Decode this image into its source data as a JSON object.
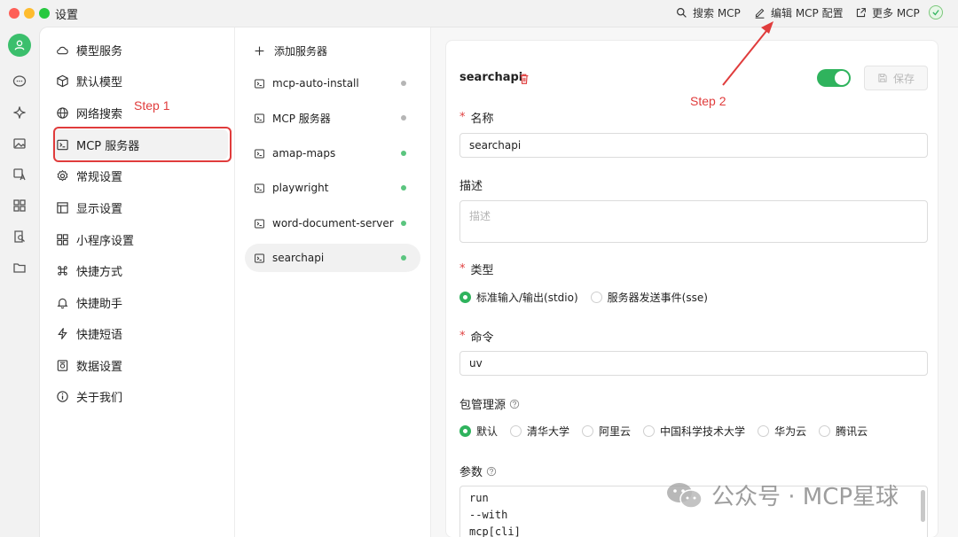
{
  "window": {
    "title": "设置"
  },
  "topbar": {
    "search_mcp": "搜索 MCP",
    "edit_mcp_config": "编辑 MCP 配置",
    "more_mcp": "更多 MCP"
  },
  "settings_menu": [
    {
      "label": "模型服务",
      "icon": "cloud-icon"
    },
    {
      "label": "默认模型",
      "icon": "cube-icon"
    },
    {
      "label": "网络搜索",
      "icon": "globe-icon"
    },
    {
      "label": "MCP 服务器",
      "icon": "terminal-icon",
      "active": true
    },
    {
      "label": "常规设置",
      "icon": "gear-icon"
    },
    {
      "label": "显示设置",
      "icon": "layout-icon"
    },
    {
      "label": "小程序设置",
      "icon": "grid-icon"
    },
    {
      "label": "快捷方式",
      "icon": "command-icon"
    },
    {
      "label": "快捷助手",
      "icon": "bell-icon"
    },
    {
      "label": "快捷短语",
      "icon": "zap-icon"
    },
    {
      "label": "数据设置",
      "icon": "database-icon"
    },
    {
      "label": "关于我们",
      "icon": "info-icon"
    }
  ],
  "annotations": {
    "step1": "Step 1",
    "step2": "Step 2"
  },
  "servers": {
    "add_label": "添加服务器",
    "items": [
      {
        "name": "mcp-auto-install",
        "status": "inactive"
      },
      {
        "name": "MCP 服务器",
        "status": "inactive"
      },
      {
        "name": "amap-maps",
        "status": "active"
      },
      {
        "name": "playwright",
        "status": "active"
      },
      {
        "name": "word-document-server",
        "status": "active"
      },
      {
        "name": "searchapi",
        "status": "active",
        "selected": true
      }
    ]
  },
  "detail": {
    "title": "searchapi",
    "enabled": true,
    "save_label": "保存",
    "name_label": "名称",
    "name_value": "searchapi",
    "desc_label": "描述",
    "desc_placeholder": "描述",
    "type_label": "类型",
    "type_options": [
      "标准输入/输出(stdio)",
      "服务器发送事件(sse)"
    ],
    "type_selected": 0,
    "command_label": "命令",
    "command_value": "uv",
    "registry_label": "包管理源",
    "registry_options": [
      "默认",
      "清华大学",
      "阿里云",
      "中国科学技术大学",
      "华为云",
      "腾讯云"
    ],
    "registry_selected": 0,
    "args_label": "参数",
    "args_lines": [
      "run",
      "--with",
      "mcp[cli]"
    ]
  },
  "watermark": {
    "text": "公众号 · MCP星球"
  },
  "colors": {
    "accent": "#2fb35d",
    "annotation": "#e03c3c",
    "inactive_dot": "#b5b5b5"
  }
}
